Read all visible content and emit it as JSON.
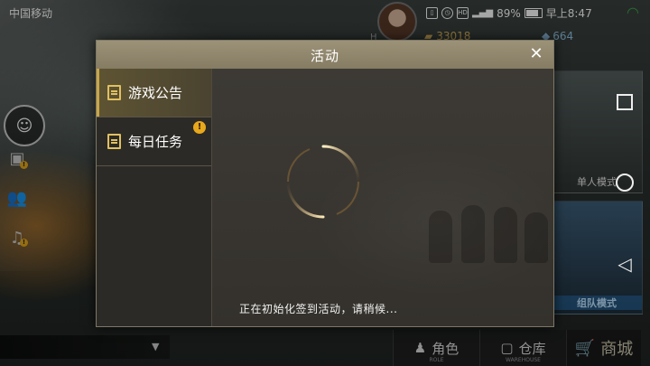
{
  "status_bar": {
    "carrier": "中国移动",
    "battery": "89%",
    "time": "早上8:47",
    "icons": [
      "vibrate-icon",
      "alarm-icon",
      "hd-icon",
      "signal-icon",
      "battery-icon",
      "wifi-icon"
    ]
  },
  "hud": {
    "player_name": "H",
    "gold": "33018",
    "gems": "664"
  },
  "dialog": {
    "title": "活动",
    "close_symbol": "✕",
    "tabs": [
      {
        "label": "游戏公告",
        "active": true,
        "badge": ""
      },
      {
        "label": "每日任务",
        "active": false,
        "badge": "!"
      }
    ],
    "loading_text": "正在初始化签到活动，请稍候..."
  },
  "mode_cards": {
    "solo": "单人模式",
    "team": "组队模式"
  },
  "bottom_bar": {
    "role_label": "角色",
    "role_sub": "ROLE",
    "warehouse_label": "仓库",
    "warehouse_sub": "WAREHOUSE",
    "shop_label": "商城"
  },
  "colors": {
    "accent_gold": "#c9a64a",
    "badge": "#e8a81c",
    "header": "#9c9278",
    "team_blue": "#2e6ea8"
  }
}
